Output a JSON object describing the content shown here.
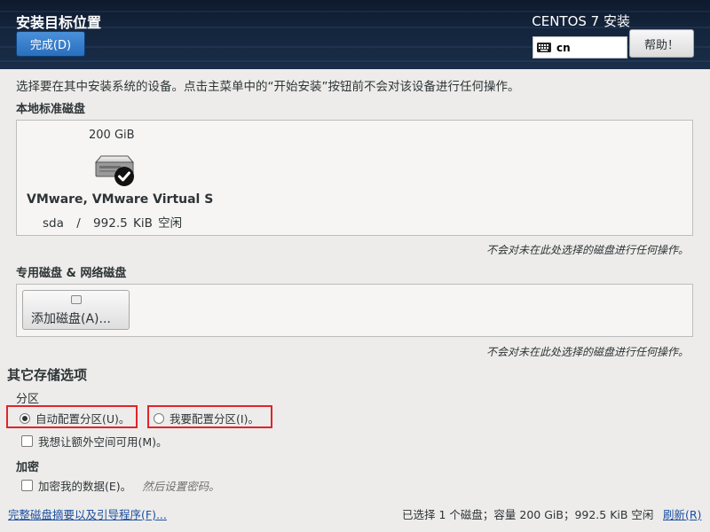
{
  "header": {
    "title": "安装目标位置",
    "done_label": "完成(D)",
    "product": "CENTOS 7 安装",
    "keyboard_layout": "cn",
    "help_label": "帮助！"
  },
  "intro": "选择要在其中安装系统的设备。点击主菜单中的“开始安装”按钮前不会对该设备进行任何操作。",
  "local_disks": {
    "label": "本地标准磁盘",
    "disk": {
      "size": "200 GiB",
      "name": "VMware, VMware Virtual S",
      "device": "sda",
      "separator": "/",
      "free": "992.5 KiB 空闲",
      "selected": true
    },
    "note": "不会对未在此处选择的磁盘进行任何操作。"
  },
  "special_disks": {
    "label": "专用磁盘 & 网络磁盘",
    "add_label": "添加磁盘(A)...",
    "note": "不会对未在此处选择的磁盘进行任何操作。"
  },
  "other_options": {
    "heading": "其它存储选项",
    "partitioning": {
      "label": "分区",
      "auto_label": "自动配置分区(U)。",
      "manual_label": "我要配置分区(I)。",
      "selected": "auto",
      "extra_space_label": "我想让额外空间可用(M)。"
    },
    "encryption": {
      "label": "加密",
      "encrypt_label": "加密我的数据(E)。",
      "hint": "然后设置密码。"
    }
  },
  "footer": {
    "summary_link": "完整磁盘摘要以及引导程序(F)...",
    "status": "已选择 1 个磁盘；容量 200 GiB；992.5 KiB 空闲",
    "refresh_link": "刷新(R)"
  },
  "colors": {
    "header_bg": "#14253d",
    "accent": "#2a6fbd",
    "highlight": "#e0242b",
    "link": "#1c4fa0"
  }
}
